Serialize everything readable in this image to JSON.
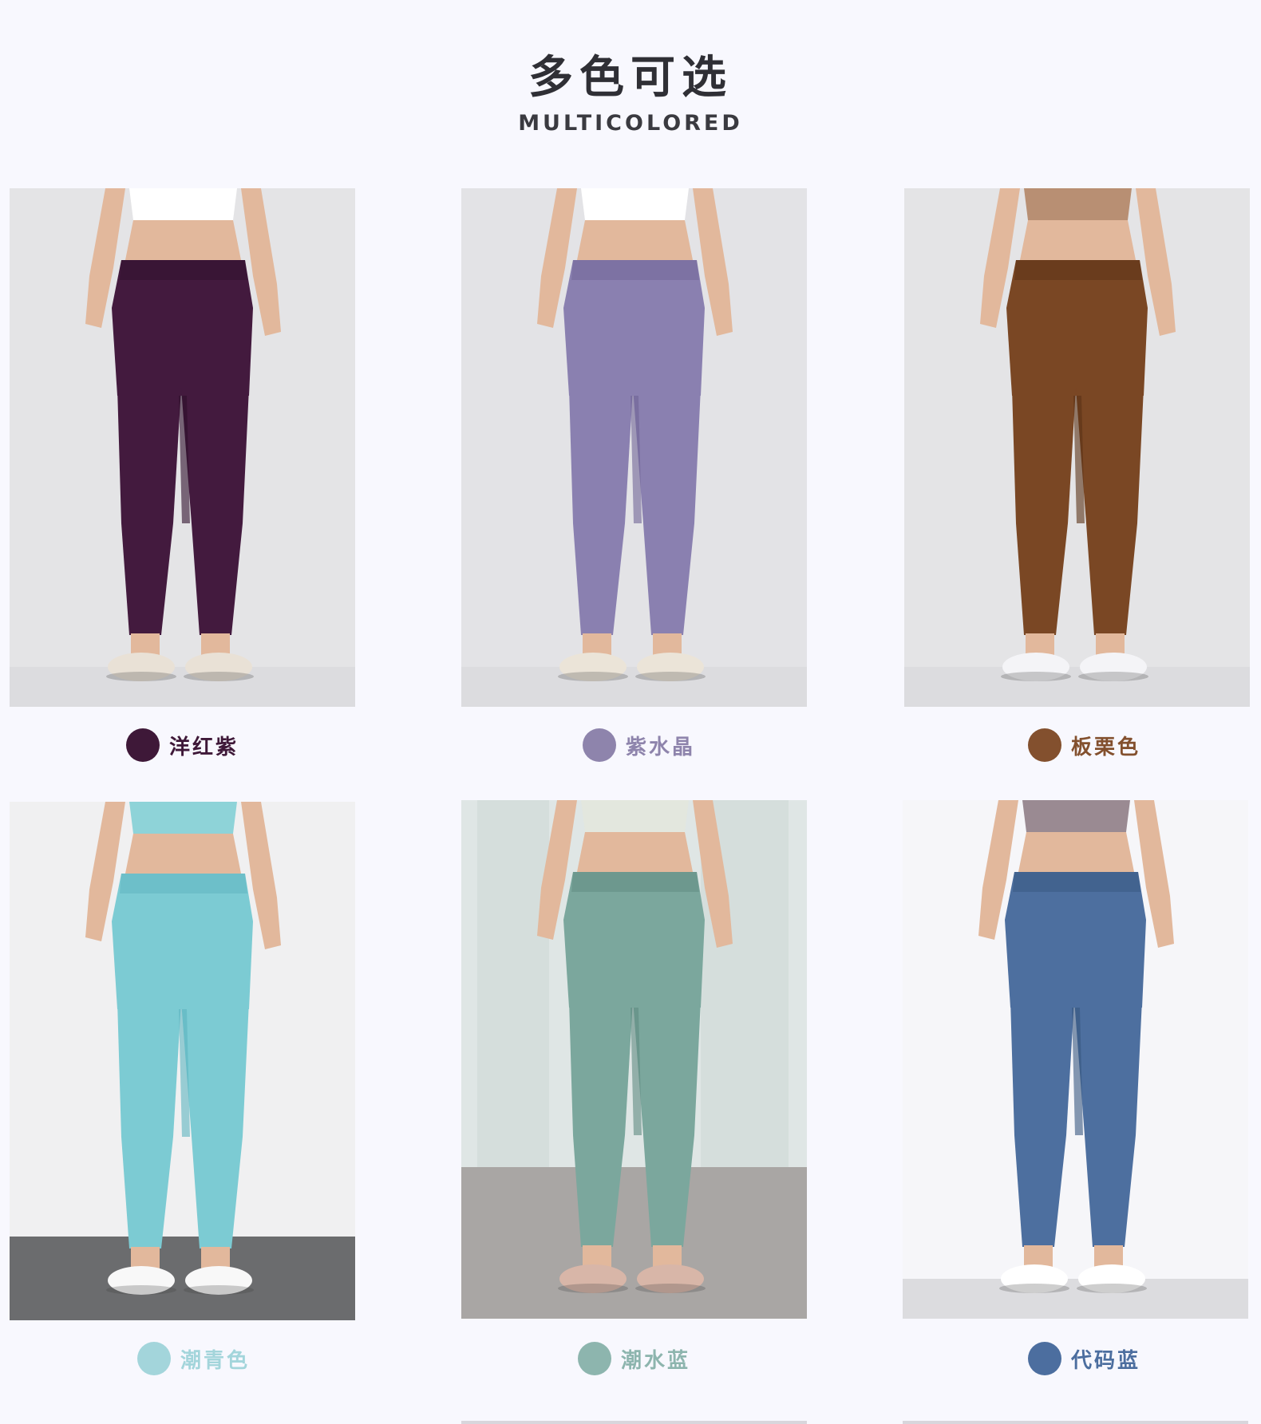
{
  "header": {
    "title": "多色可选",
    "subtitle": "MULTICOLORED"
  },
  "colors": [
    {
      "name": "洋红紫",
      "swatch": "#3e1838",
      "text_color": "#3e1838",
      "pants": "#431a3e",
      "pants_shade": "#2f0f2c",
      "background": "#e4e4e6",
      "top": "#ffffff",
      "shoes": "#e9e1d6",
      "view": "back"
    },
    {
      "name": "紫水晶",
      "swatch": "#8e84ac",
      "text_color": "#8e84ac",
      "pants": "#8a80b0",
      "pants_shade": "#6f6496",
      "background": "#e3e3e6",
      "top": "#ffffff",
      "shoes": "#ebe4d8",
      "view": "back"
    },
    {
      "name": "板栗色",
      "swatch": "#83502e",
      "text_color": "#83502e",
      "pants": "#7a4724",
      "pants_shade": "#5a3216",
      "background": "#e4e4e6",
      "top": "#b88f73",
      "shoes": "#f4f4f7",
      "view": "back"
    },
    {
      "name": "潮青色",
      "swatch": "#a3d5db",
      "text_color": "#a3d5db",
      "pants": "#7ccbd3",
      "pants_shade": "#5db4bf",
      "background": "#f0f0f1",
      "top": "#8ed3d8",
      "shoes": "#f8f8f8",
      "view": "front"
    },
    {
      "name": "潮水蓝",
      "swatch": "#8db5ae",
      "text_color": "#8db5ae",
      "pants": "#7ba79d",
      "pants_shade": "#5f8a80",
      "background": "#dfe6e5",
      "top": "#e3e7de",
      "shoes": "#d8b6a8",
      "view": "front"
    },
    {
      "name": "代码蓝",
      "swatch": "#4c6e9f",
      "text_color": "#4c6e9f",
      "pants": "#4d6f9f",
      "pants_shade": "#37577f",
      "background": "#f6f6f9",
      "top": "#9a8a92",
      "shoes": "#ffffff",
      "view": "side"
    }
  ]
}
